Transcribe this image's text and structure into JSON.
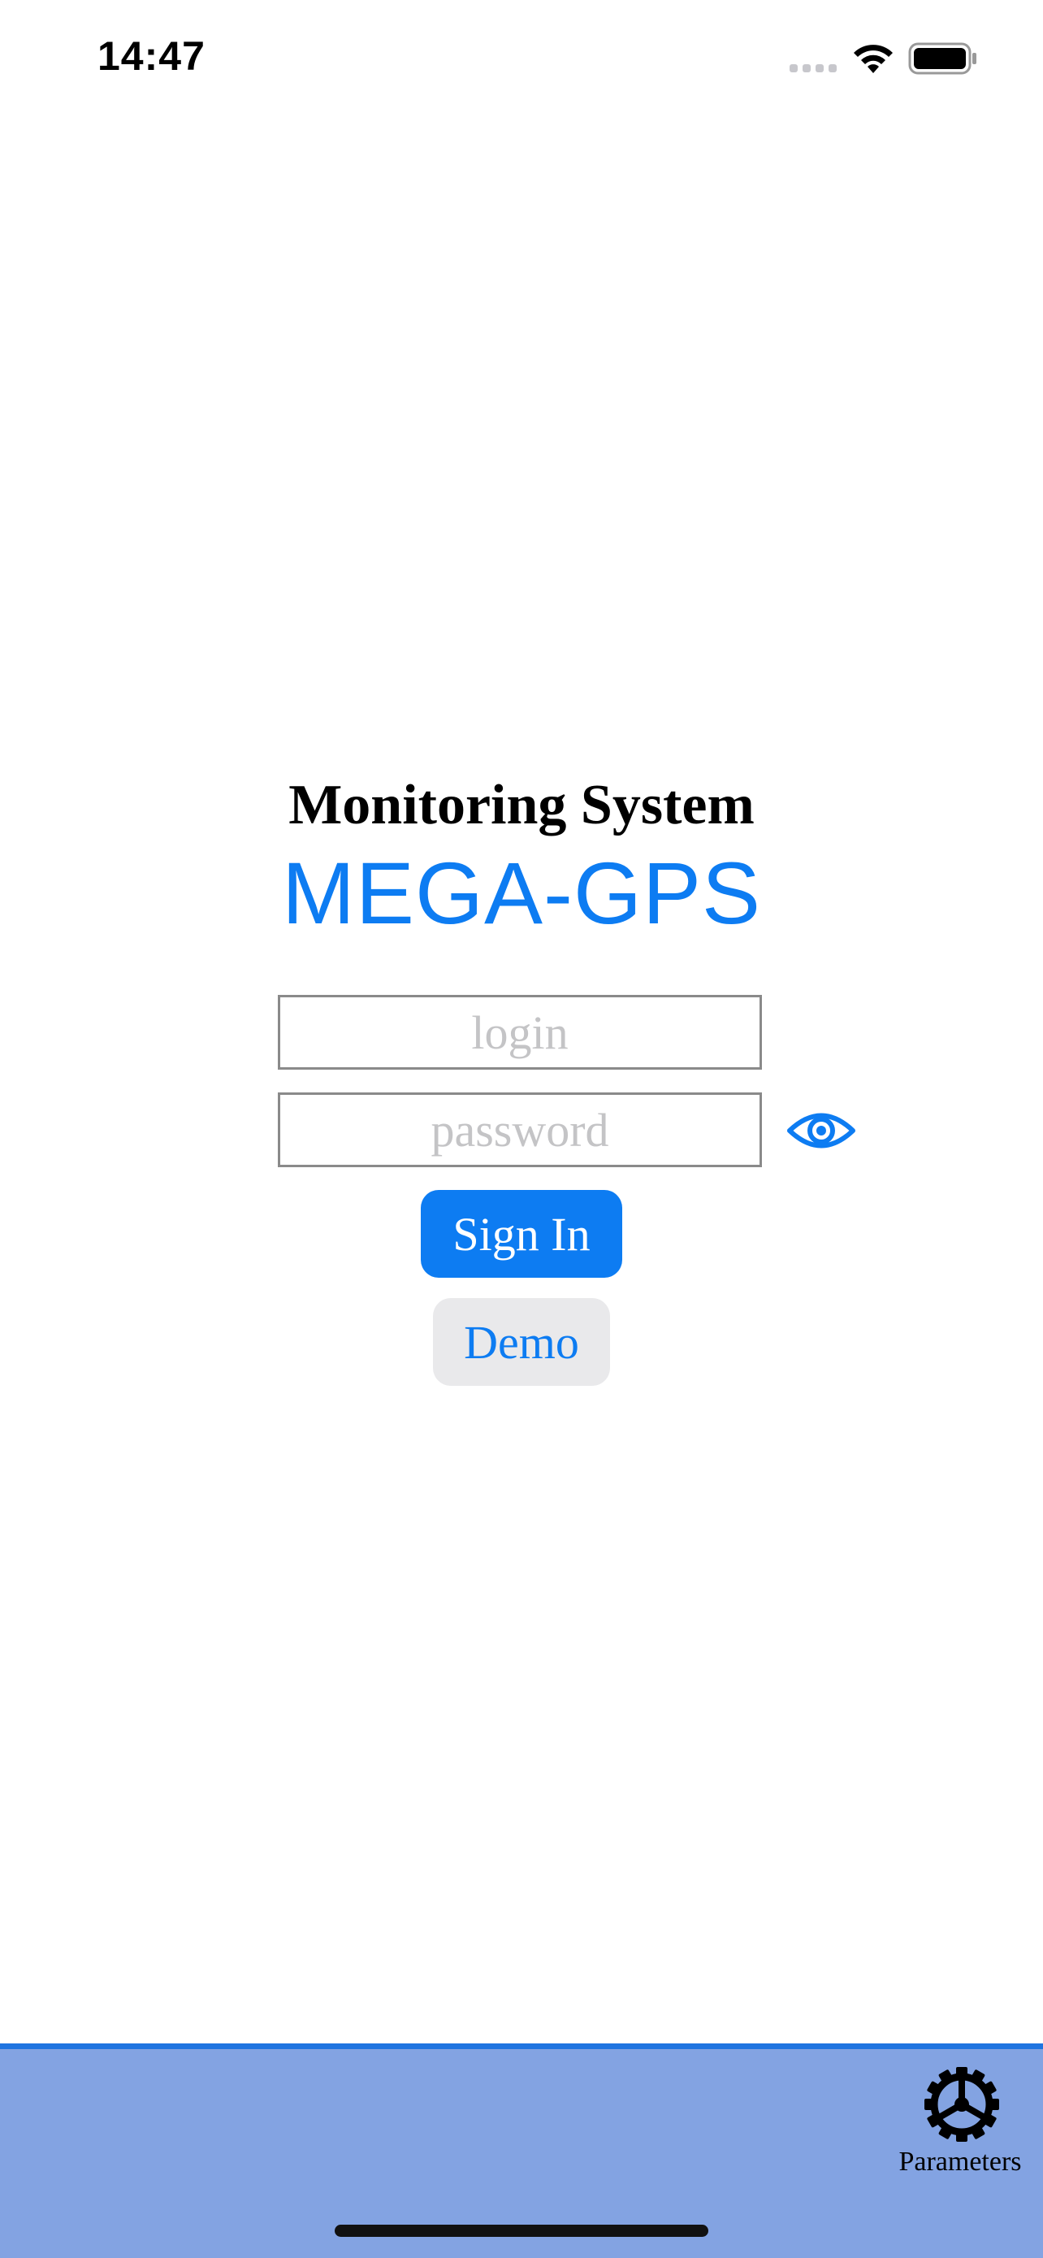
{
  "status_bar": {
    "time": "14:47",
    "icons": [
      "cellular-signal-icon",
      "wifi-icon",
      "battery-icon"
    ]
  },
  "header": {
    "subtitle": "Monitoring System",
    "brand": "MEGA-GPS"
  },
  "form": {
    "login": {
      "value": "",
      "placeholder": "login"
    },
    "password": {
      "value": "",
      "placeholder": "password",
      "toggle_icon": "eye-icon"
    },
    "signin_label": "Sign In",
    "demo_label": "Demo"
  },
  "tab_bar": {
    "items": [
      {
        "label": "Parameters",
        "icon": "gear-icon"
      }
    ]
  },
  "colors": {
    "accent": "#0d7cf2",
    "tab_bar_bg": "#83a3e2",
    "tab_bar_border": "#1f74e0",
    "demo_bg": "#e9e9eb",
    "placeholder": "#c4c4c6"
  }
}
